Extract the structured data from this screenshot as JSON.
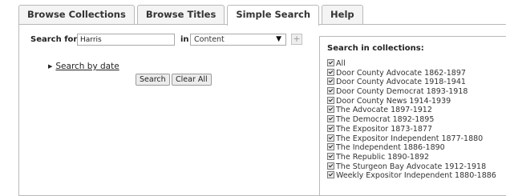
{
  "tabs": [
    {
      "label": "Browse Collections",
      "active": false
    },
    {
      "label": "Browse Titles",
      "active": false
    },
    {
      "label": "Simple Search",
      "active": true
    },
    {
      "label": "Help",
      "active": false
    }
  ],
  "search": {
    "label": "Search for",
    "value": "Harris",
    "in_label": "in",
    "field_selected": "Content",
    "add_symbol": "+"
  },
  "date_toggle": {
    "label": "Search by date"
  },
  "buttons": {
    "search": "Search",
    "clear": "Clear All"
  },
  "collections": {
    "title": "Search in collections:",
    "items": [
      "All",
      "Door County Advocate 1862-1897",
      "Door County Advocate 1918-1941",
      "Door County Democrat 1893-1918",
      "Door County News 1914-1939",
      "The Advocate 1897-1912",
      "The Democrat 1892-1895",
      "The Expositor 1873-1877",
      "The Expositor Independent 1877-1880",
      "The Independent 1886-1890",
      "The Republic 1890-1892",
      "The Sturgeon Bay Advocate 1912-1918",
      "Weekly Expositor Independent 1880-1886"
    ]
  }
}
